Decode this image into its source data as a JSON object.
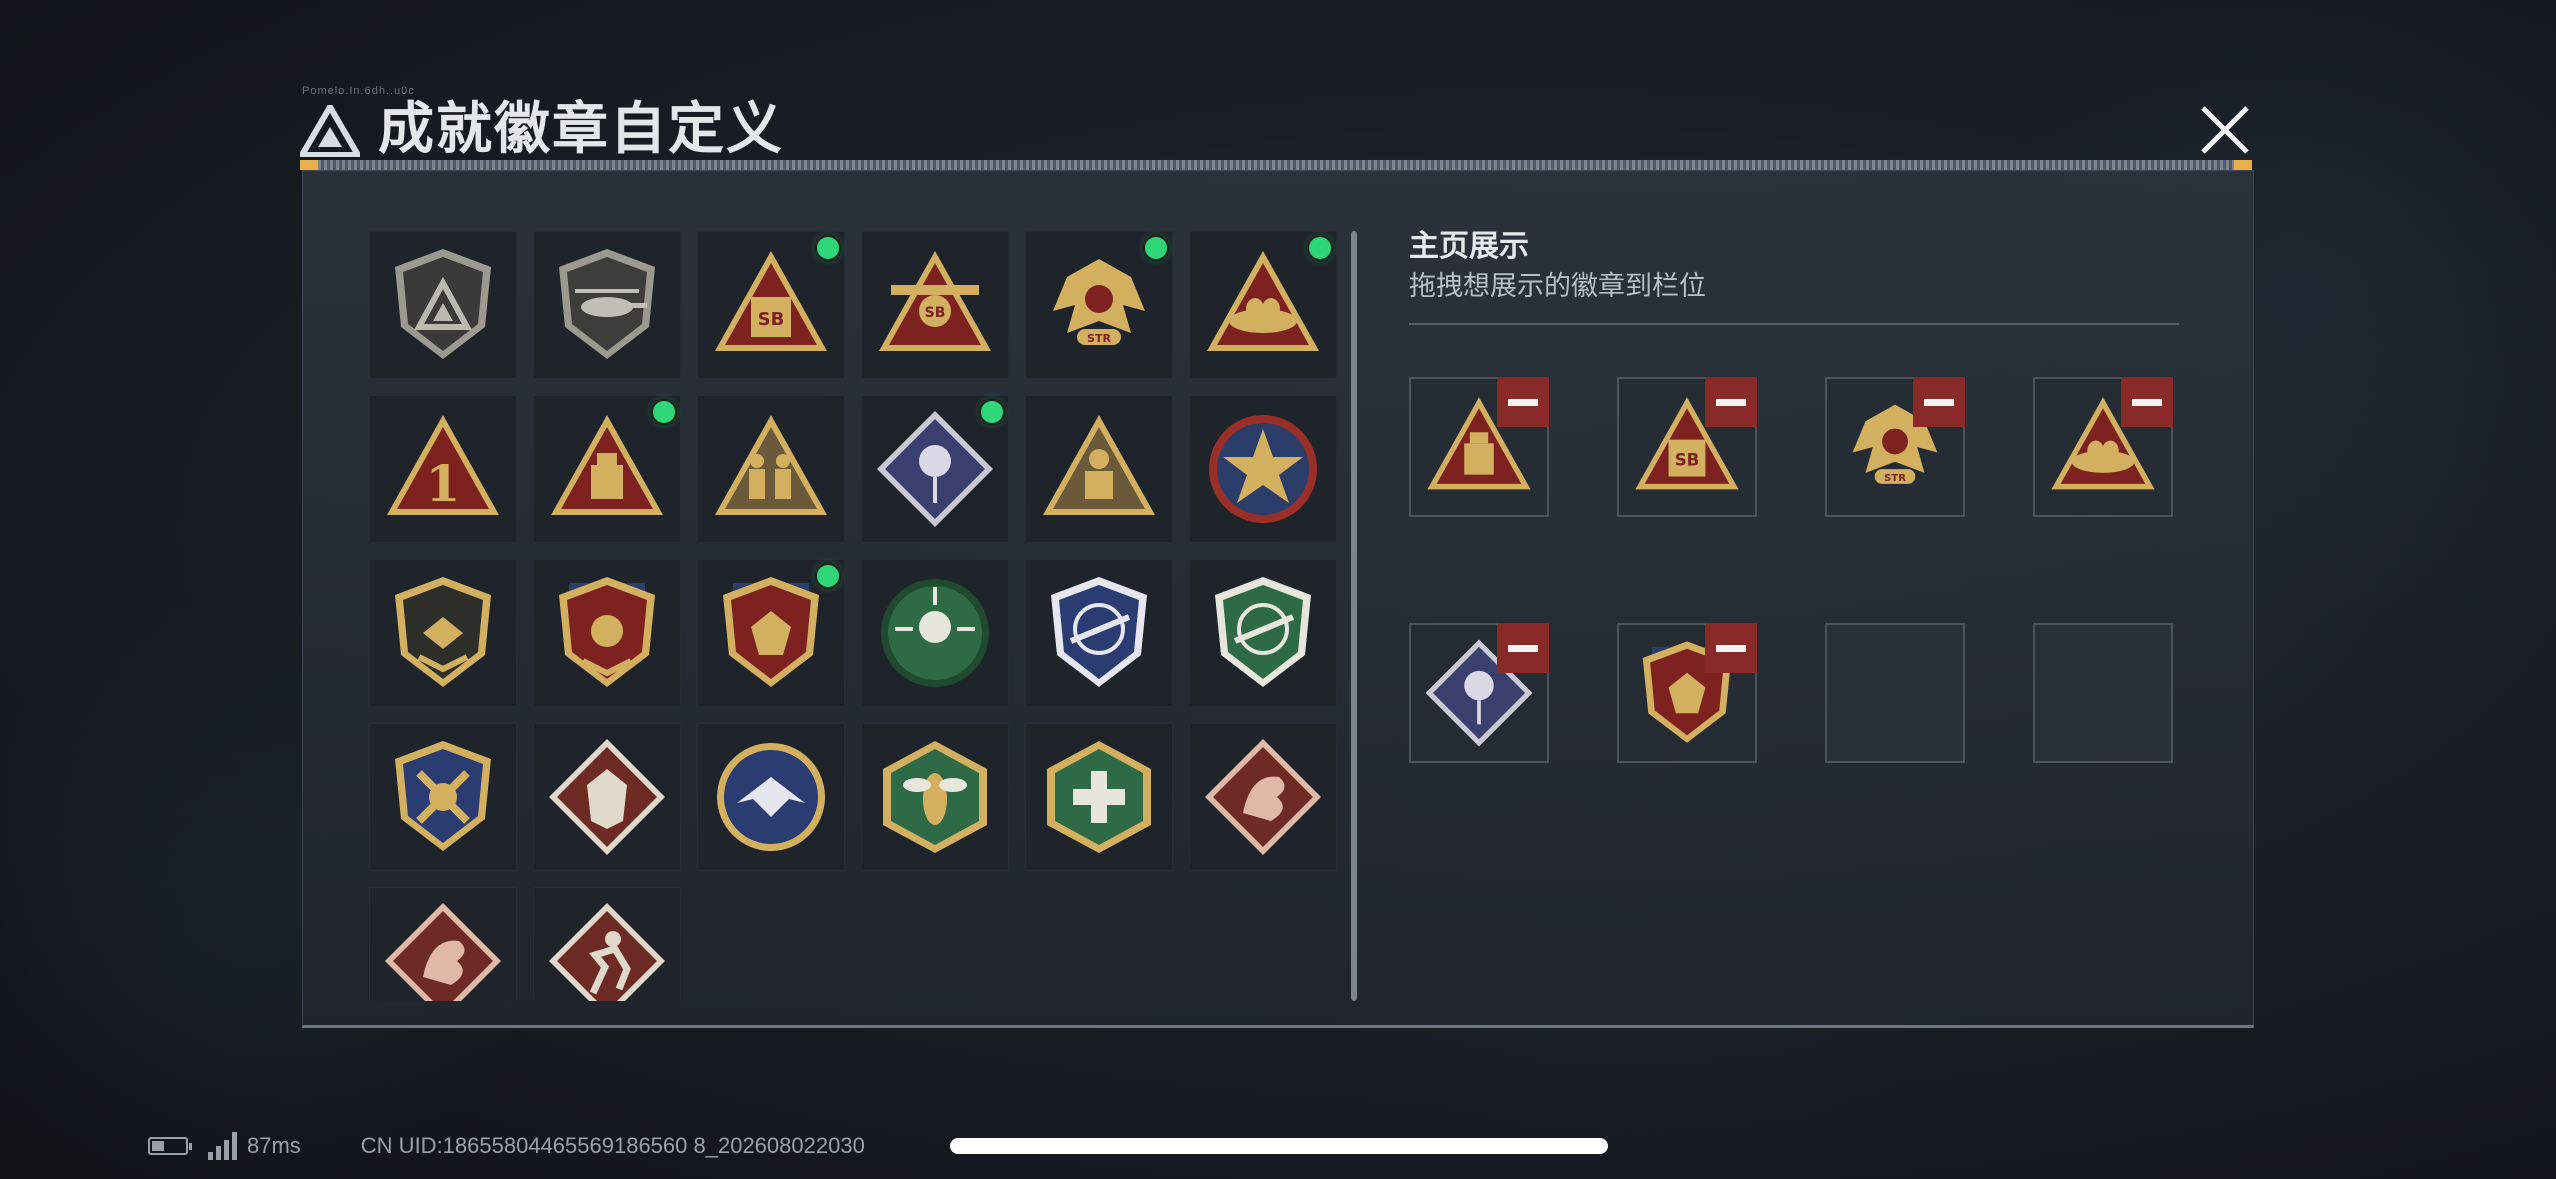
{
  "header": {
    "title": "成就徽章自定义",
    "tiny_label": "Pomelo.In.6dh..u0c"
  },
  "colors": {
    "accent_gold": "#d2b060",
    "badge_red": "#7e2220",
    "available_dot": "#2fd67a",
    "remove_button": "#8a2a28"
  },
  "badges": [
    {
      "icon": "mountain-shield-badge",
      "dot": false
    },
    {
      "icon": "helicopter-shield-badge",
      "dot": false
    },
    {
      "icon": "sb-crate-triangle-badge",
      "dot": true
    },
    {
      "icon": "sb-winged-triangle-badge",
      "dot": false
    },
    {
      "icon": "str-eagle-badge",
      "dot": true
    },
    {
      "icon": "nest-egg-triangle-badge",
      "dot": true
    },
    {
      "icon": "number-one-triangle-badge",
      "dot": false
    },
    {
      "icon": "drive-triangle-badge",
      "dot": true
    },
    {
      "icon": "soldiers-triangle-badge",
      "dot": false
    },
    {
      "icon": "rose-diamond-badge",
      "dot": true
    },
    {
      "icon": "operator-triangle-badge",
      "dot": false
    },
    {
      "icon": "star-roundel-badge",
      "dot": false
    },
    {
      "icon": "dark-shield-badge",
      "dot": false
    },
    {
      "icon": "crest-shield-badge",
      "dot": false
    },
    {
      "icon": "gem-crest-badge",
      "dot": true
    },
    {
      "icon": "skull-crosshair-badge",
      "dot": false
    },
    {
      "icon": "rifle-crosshair-blue-badge",
      "dot": false
    },
    {
      "icon": "rifle-crosshair-green-badge",
      "dot": false
    },
    {
      "icon": "crossed-wrench-badge",
      "dot": false
    },
    {
      "icon": "wolf-diamond-badge",
      "dot": false
    },
    {
      "icon": "eagle-roundel-badge",
      "dot": false
    },
    {
      "icon": "hornet-hexagon-badge",
      "dot": false
    },
    {
      "icon": "medic-hexagon-badge",
      "dot": false
    },
    {
      "icon": "dragon-diamond-badge",
      "dot": false
    },
    {
      "icon": "dragon-diamond-badge-2",
      "dot": false
    },
    {
      "icon": "runner-diamond-badge",
      "dot": false
    }
  ],
  "showcase": {
    "title": "主页展示",
    "subtitle": "拖拽想展示的徽章到栏位",
    "slots": [
      {
        "icon": "drive-triangle-badge",
        "filled": true
      },
      {
        "icon": "sb-crate-triangle-badge",
        "filled": true
      },
      {
        "icon": "str-eagle-badge",
        "filled": true
      },
      {
        "icon": "nest-egg-triangle-badge",
        "filled": true
      },
      {
        "icon": "rose-diamond-badge",
        "filled": true
      },
      {
        "icon": "gem-crest-badge",
        "filled": true
      },
      {
        "icon": "",
        "filled": false
      },
      {
        "icon": "",
        "filled": false
      }
    ]
  },
  "footer": {
    "ping": "87ms",
    "uid": "CN UID:18655804465569186560 8_202608022030"
  }
}
